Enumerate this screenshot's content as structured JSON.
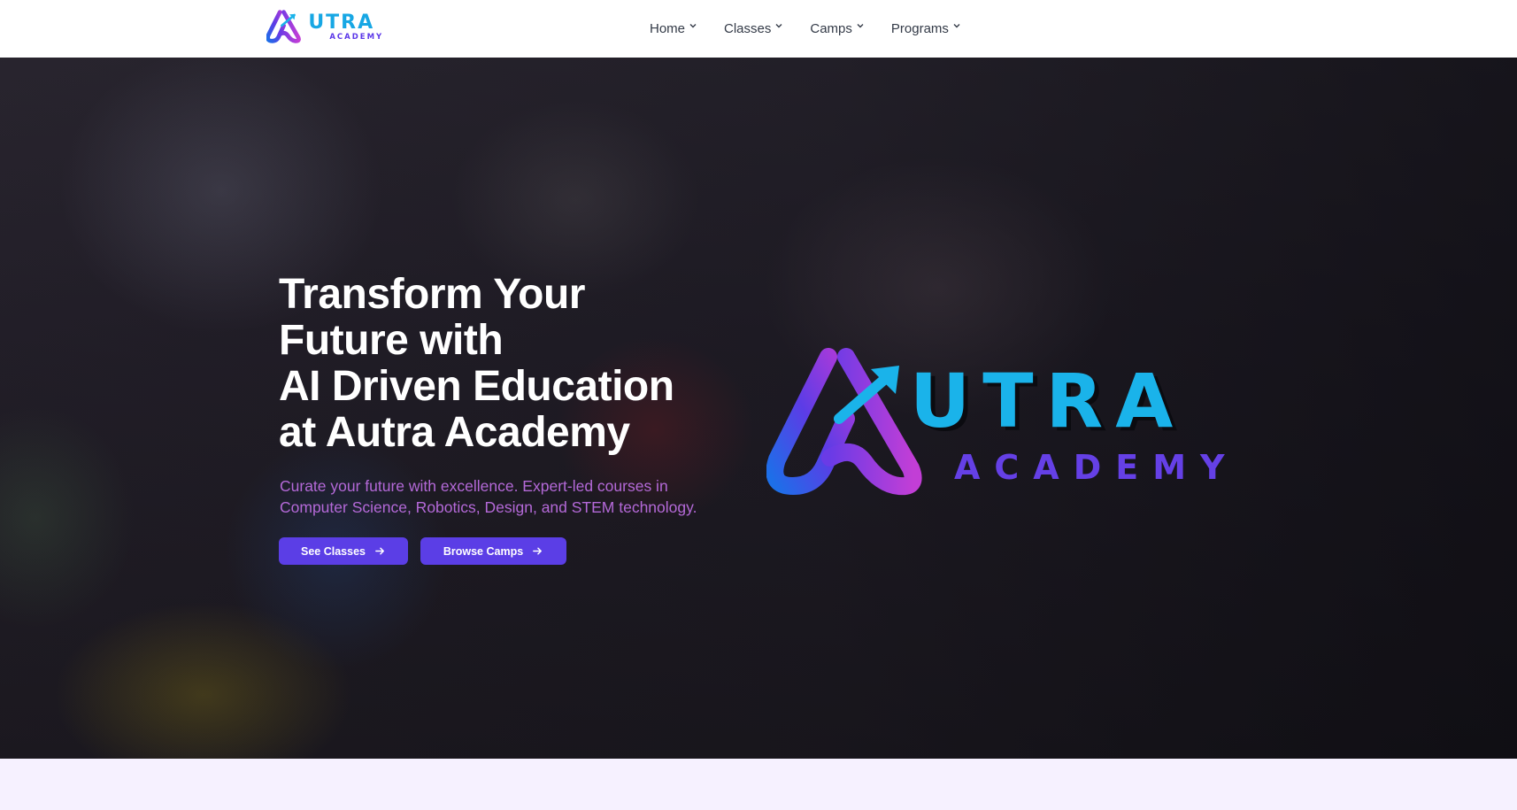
{
  "brand": {
    "name": "AUTRA",
    "sub": "ACADEMY",
    "name_rest": "UTRA"
  },
  "nav": {
    "items": [
      {
        "label": "Home"
      },
      {
        "label": "Classes"
      },
      {
        "label": "Camps"
      },
      {
        "label": "Programs"
      }
    ]
  },
  "hero": {
    "title_lines": [
      "Transform Your",
      "Future with",
      "AI Driven Education",
      "at Autra Academy"
    ],
    "subtitle_lines": [
      "Curate your future with excellence. Expert-led courses in",
      "Computer Science, Robotics, Design, and STEM technology."
    ],
    "buttons": [
      {
        "label": "See Classes",
        "icon": "arrow-right-icon"
      },
      {
        "label": "Browse Camps",
        "icon": "arrow-right-icon"
      }
    ],
    "logo_word": "UTRA",
    "logo_sub": "ACADEMY"
  },
  "colors": {
    "accent": "#5b3ee6",
    "brand_cyan": "#1ab3ea",
    "subtitle": "#b469d8"
  }
}
